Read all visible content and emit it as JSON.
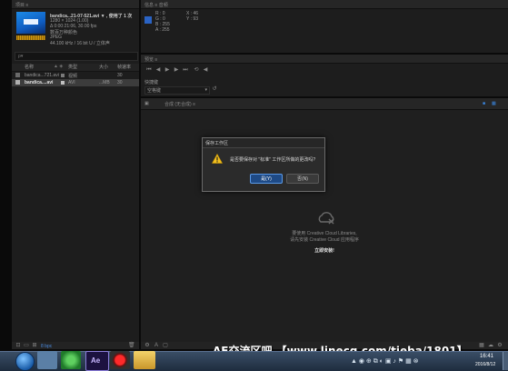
{
  "colors": {
    "accent": "#2a63c4",
    "folder": "#e0b440",
    "dialog_bg": "#2b2b2b",
    "warning": "#f2c01f"
  },
  "project_panel": {
    "tab_label": "项目 ≡",
    "file_name": "bandica...21-07-521.avi ▼ , 使用了 1 次",
    "file_meta": [
      "1280 × 1024 (1.00)",
      "Δ 0:00:21:06, 30.00 fps",
      "数百万种颜色",
      "JPEG",
      "44.100 kHz / 16 bit U / 立体声"
    ],
    "search_placeholder": "ρ▾",
    "col_name": "名称",
    "col_type": "类型",
    "col_size": "大小",
    "col_rate": "帧速率",
    "rows": [
      {
        "name": "bandica...721.avi",
        "type": "视频",
        "size": "",
        "rate": "30"
      },
      {
        "name": "bandica....avi",
        "type": "AVI",
        "size": "...MB",
        "rate": "30"
      }
    ],
    "bit_depth": "8 bpc"
  },
  "info_panel": {
    "tab_label": "信息 ≡  音频",
    "r": "R : 0",
    "g": "G : 0",
    "b": "B : 255",
    "a": "A : 255",
    "x": "X : 46",
    "y": "Y : 93"
  },
  "preview_panel": {
    "tab_label": "预览 ≡",
    "shortcut_label": "快捷键",
    "shortcut_value": "空格键"
  },
  "comp_panel": {
    "tab_label": "合成 (无合成) ≡"
  },
  "cc_libraries": {
    "line1": "要使用 Creative Cloud Libraries,",
    "line2": "请先安装 Creative Cloud 应用程序",
    "button": "立即安装!"
  },
  "dialog": {
    "title": "保存工作区",
    "message": "是否要保存对 \"标准\" 工作区所做的更改吗?",
    "yes_button": "是(Y)",
    "no_button": "否(N)"
  },
  "watermark": "AE交流区吧 【www.linecg.com/tieba/1801】",
  "taskbar": {
    "time": "16:41",
    "date": "2016/8/12"
  }
}
